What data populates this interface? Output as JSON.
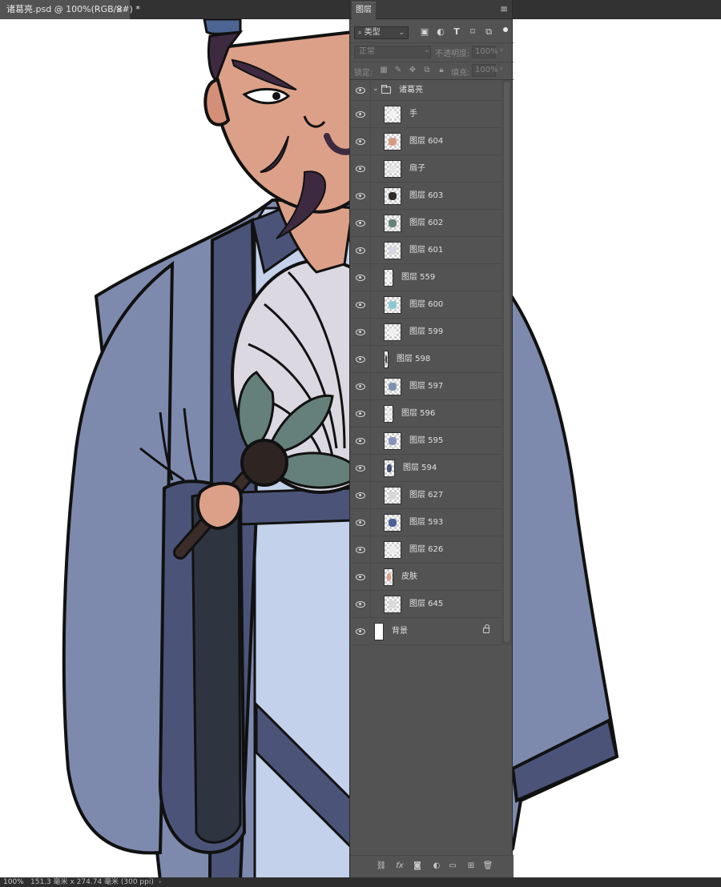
{
  "document": {
    "tab_title": "诸葛亮.psd @ 100%(RGB/8#) *",
    "close_glyph": "×"
  },
  "layers_panel": {
    "tab_label": "图层",
    "menu_icon": "panel-menu-icon",
    "filter": {
      "kind_label": "类型",
      "search_glyph": "🔍",
      "icons": [
        "image-filter-icon",
        "adjustment-filter-icon",
        "type-filter-icon",
        "shape-filter-icon",
        "smart-object-filter-icon"
      ]
    },
    "blend_mode": "正常",
    "opacity_label": "不透明度:",
    "opacity_value": "100%",
    "lock_label": "锁定:",
    "fill_label": "填充:",
    "fill_value": "100%",
    "group": {
      "name": "诸葛亮",
      "expanded": true
    },
    "layers": [
      {
        "name": "手",
        "thumb": "#f2f2f2"
      },
      {
        "name": "图层 604",
        "thumb": "#d79a82"
      },
      {
        "name": "扇子",
        "thumb": "#e6e6e6"
      },
      {
        "name": "图层 603",
        "thumb": "#2e2a28"
      },
      {
        "name": "图层 602",
        "thumb": "#66807a"
      },
      {
        "name": "图层 601",
        "thumb": "#dad5e2"
      },
      {
        "name": "图层 559",
        "thumb": "#efefef"
      },
      {
        "name": "图层 600",
        "thumb": "#8cc8d4"
      },
      {
        "name": "图层 599",
        "thumb": "#efefef"
      },
      {
        "name": "图层 598",
        "thumb": "#303030"
      },
      {
        "name": "图层 597",
        "thumb": "#8090b0"
      },
      {
        "name": "图层 596",
        "thumb": "#e8e8e8"
      },
      {
        "name": "图层 595",
        "thumb": "#8593b8"
      },
      {
        "name": "图层 594",
        "thumb": "#4b5477"
      },
      {
        "name": "图层 627",
        "thumb": "#d8d8d8"
      },
      {
        "name": "图层 593",
        "thumb": "#4d5f9a"
      },
      {
        "name": "图层 626",
        "thumb": "#ececec"
      },
      {
        "name": "皮肤",
        "thumb": "#dca088"
      },
      {
        "name": "图层 645",
        "thumb": "#dadada"
      }
    ],
    "background_layer": {
      "name": "背景",
      "locked": true
    },
    "footer_icons": [
      "link-layers-icon",
      "fx-icon",
      "layer-mask-icon",
      "adjustment-layer-icon",
      "new-group-icon",
      "new-layer-icon",
      "delete-layer-icon"
    ]
  },
  "statusbar": {
    "zoom": "100%",
    "doc_size": "151.3 毫米 x 274.74 毫米 (300 ppi)"
  },
  "artwork": {
    "robe_color": "#7e8aad",
    "robe_dark": "#4b5478",
    "inner_robe": "#c3d1ea",
    "skin": "#dca088",
    "hair": "#3d2a41",
    "fan": "#dcd8e2",
    "fan_leaves": "#65807b"
  }
}
